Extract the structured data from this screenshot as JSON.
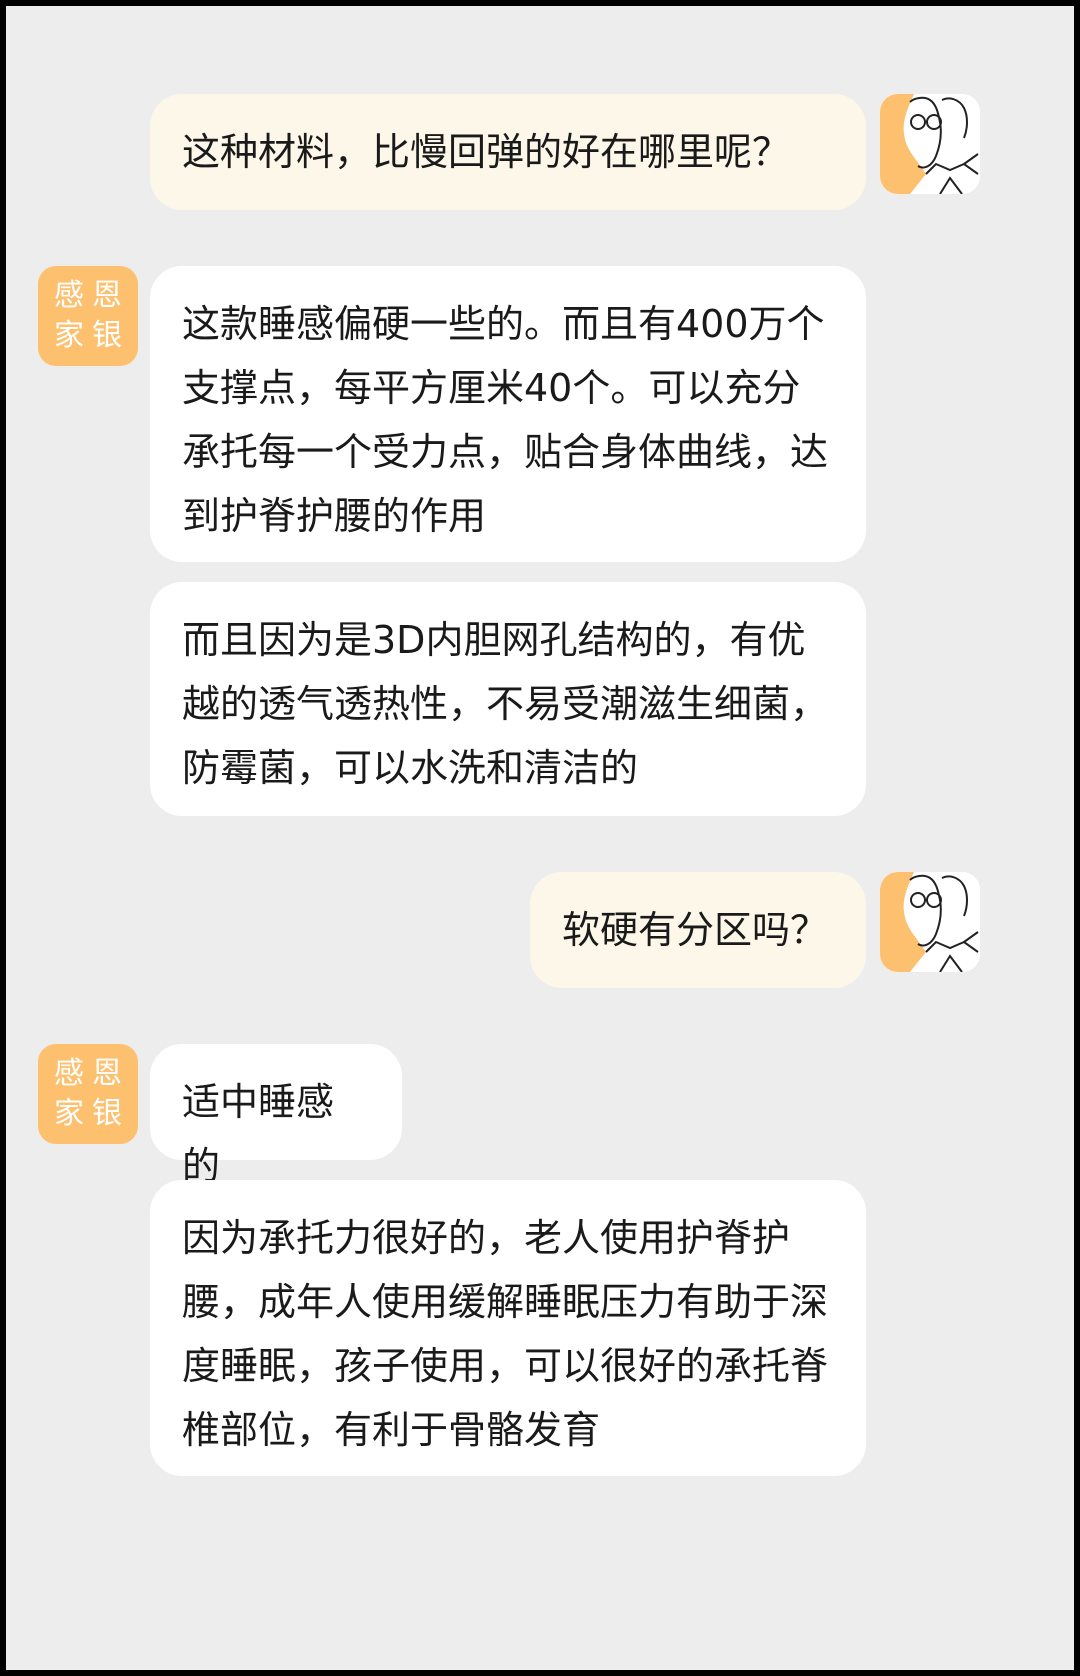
{
  "user_avatar_icon": "cartoon-person-with-glasses-icon",
  "shop_avatar": {
    "chars": [
      "感",
      "恩",
      "家",
      "银"
    ]
  },
  "messages": [
    {
      "side": "sent",
      "text": "这种材料，比慢回弹的好在哪里呢？"
    },
    {
      "side": "received",
      "text": "这款睡感偏硬一些的。而且有400万个支撑点，每平方厘米40个。可以充分承托每一个受力点，贴合身体曲线，达到护脊护腰的作用"
    },
    {
      "side": "received",
      "text": "而且因为是3D内胆网孔结构的，有优越的透气透热性，不易受潮滋生细菌，防霉菌，可以水洗和清洁的"
    },
    {
      "side": "sent",
      "text": "软硬有分区吗？"
    },
    {
      "side": "received",
      "text": "适中睡感的"
    },
    {
      "side": "received",
      "text": "因为承托力很好的，老人使用护脊护腰，成年人使用缓解睡眠压力有助于深度睡眠，孩子使用，可以很好的承托脊椎部位，有利于骨骼发育"
    }
  ],
  "colors": {
    "chat_background": "#ededed",
    "sent_bubble": "#fdf7ea",
    "received_bubble": "#ffffff",
    "shop_avatar": "#fcc06e",
    "user_avatar_accent": "#fcc06e"
  }
}
